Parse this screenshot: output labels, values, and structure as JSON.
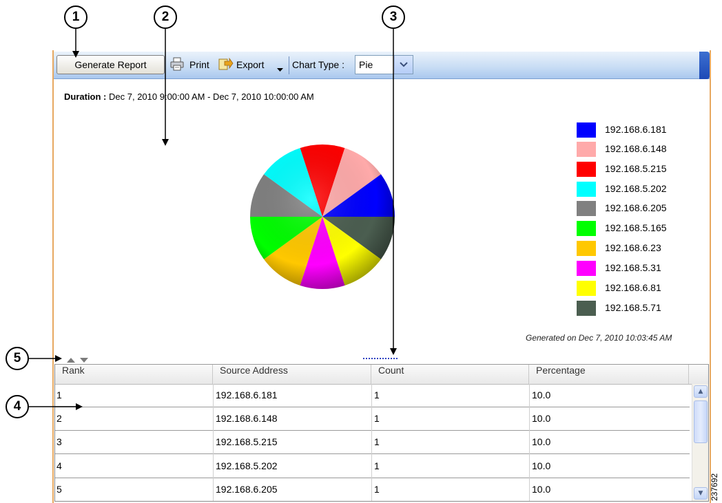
{
  "callouts": [
    "1",
    "2",
    "3",
    "4",
    "5"
  ],
  "toolbar": {
    "generate_label": "Generate Report",
    "print_label": "Print",
    "export_label": "Export",
    "chart_type_label": "Chart Type :",
    "chart_type_value": "Pie"
  },
  "report": {
    "duration_label": "Duration :",
    "duration_value": "Dec 7, 2010 9:00:00 AM - Dec 7, 2010 10:00:00 AM",
    "generated": "Generated on Dec 7, 2010 10:03:45 AM"
  },
  "chart_data": {
    "type": "pie",
    "categories": [
      "192.168.6.181",
      "192.168.6.148",
      "192.168.5.215",
      "192.168.5.202",
      "192.168.6.205",
      "192.168.5.165",
      "192.168.6.23",
      "192.168.5.31",
      "192.168.6.81",
      "192.168.5.71"
    ],
    "values": [
      10,
      10,
      10,
      10,
      10,
      10,
      10,
      10,
      10,
      10
    ],
    "colors": [
      "#0000ff",
      "#ffaaaa",
      "#ff0000",
      "#00ffff",
      "#808080",
      "#00ff00",
      "#ffc800",
      "#ff00ff",
      "#ffff00",
      "#4b5e50"
    ],
    "legend_position": "right"
  },
  "table": {
    "columns": [
      "Rank",
      "Source Address",
      "Count",
      "Percentage"
    ],
    "rows": [
      [
        "1",
        "192.168.6.181",
        "1",
        "10.0"
      ],
      [
        "2",
        "192.168.6.148",
        "1",
        "10.0"
      ],
      [
        "3",
        "192.168.5.215",
        "1",
        "10.0"
      ],
      [
        "4",
        "192.168.5.202",
        "1",
        "10.0"
      ],
      [
        "5",
        "192.168.6.205",
        "1",
        "10.0"
      ]
    ]
  },
  "icons": {
    "print": "printer-icon",
    "export": "export-icon",
    "dropdown": "chevron-down-icon",
    "sort": "sort-arrows-icon",
    "scroll_up": "scroll-up-icon",
    "scroll_down": "scroll-down-icon"
  },
  "figure_id": "237692"
}
